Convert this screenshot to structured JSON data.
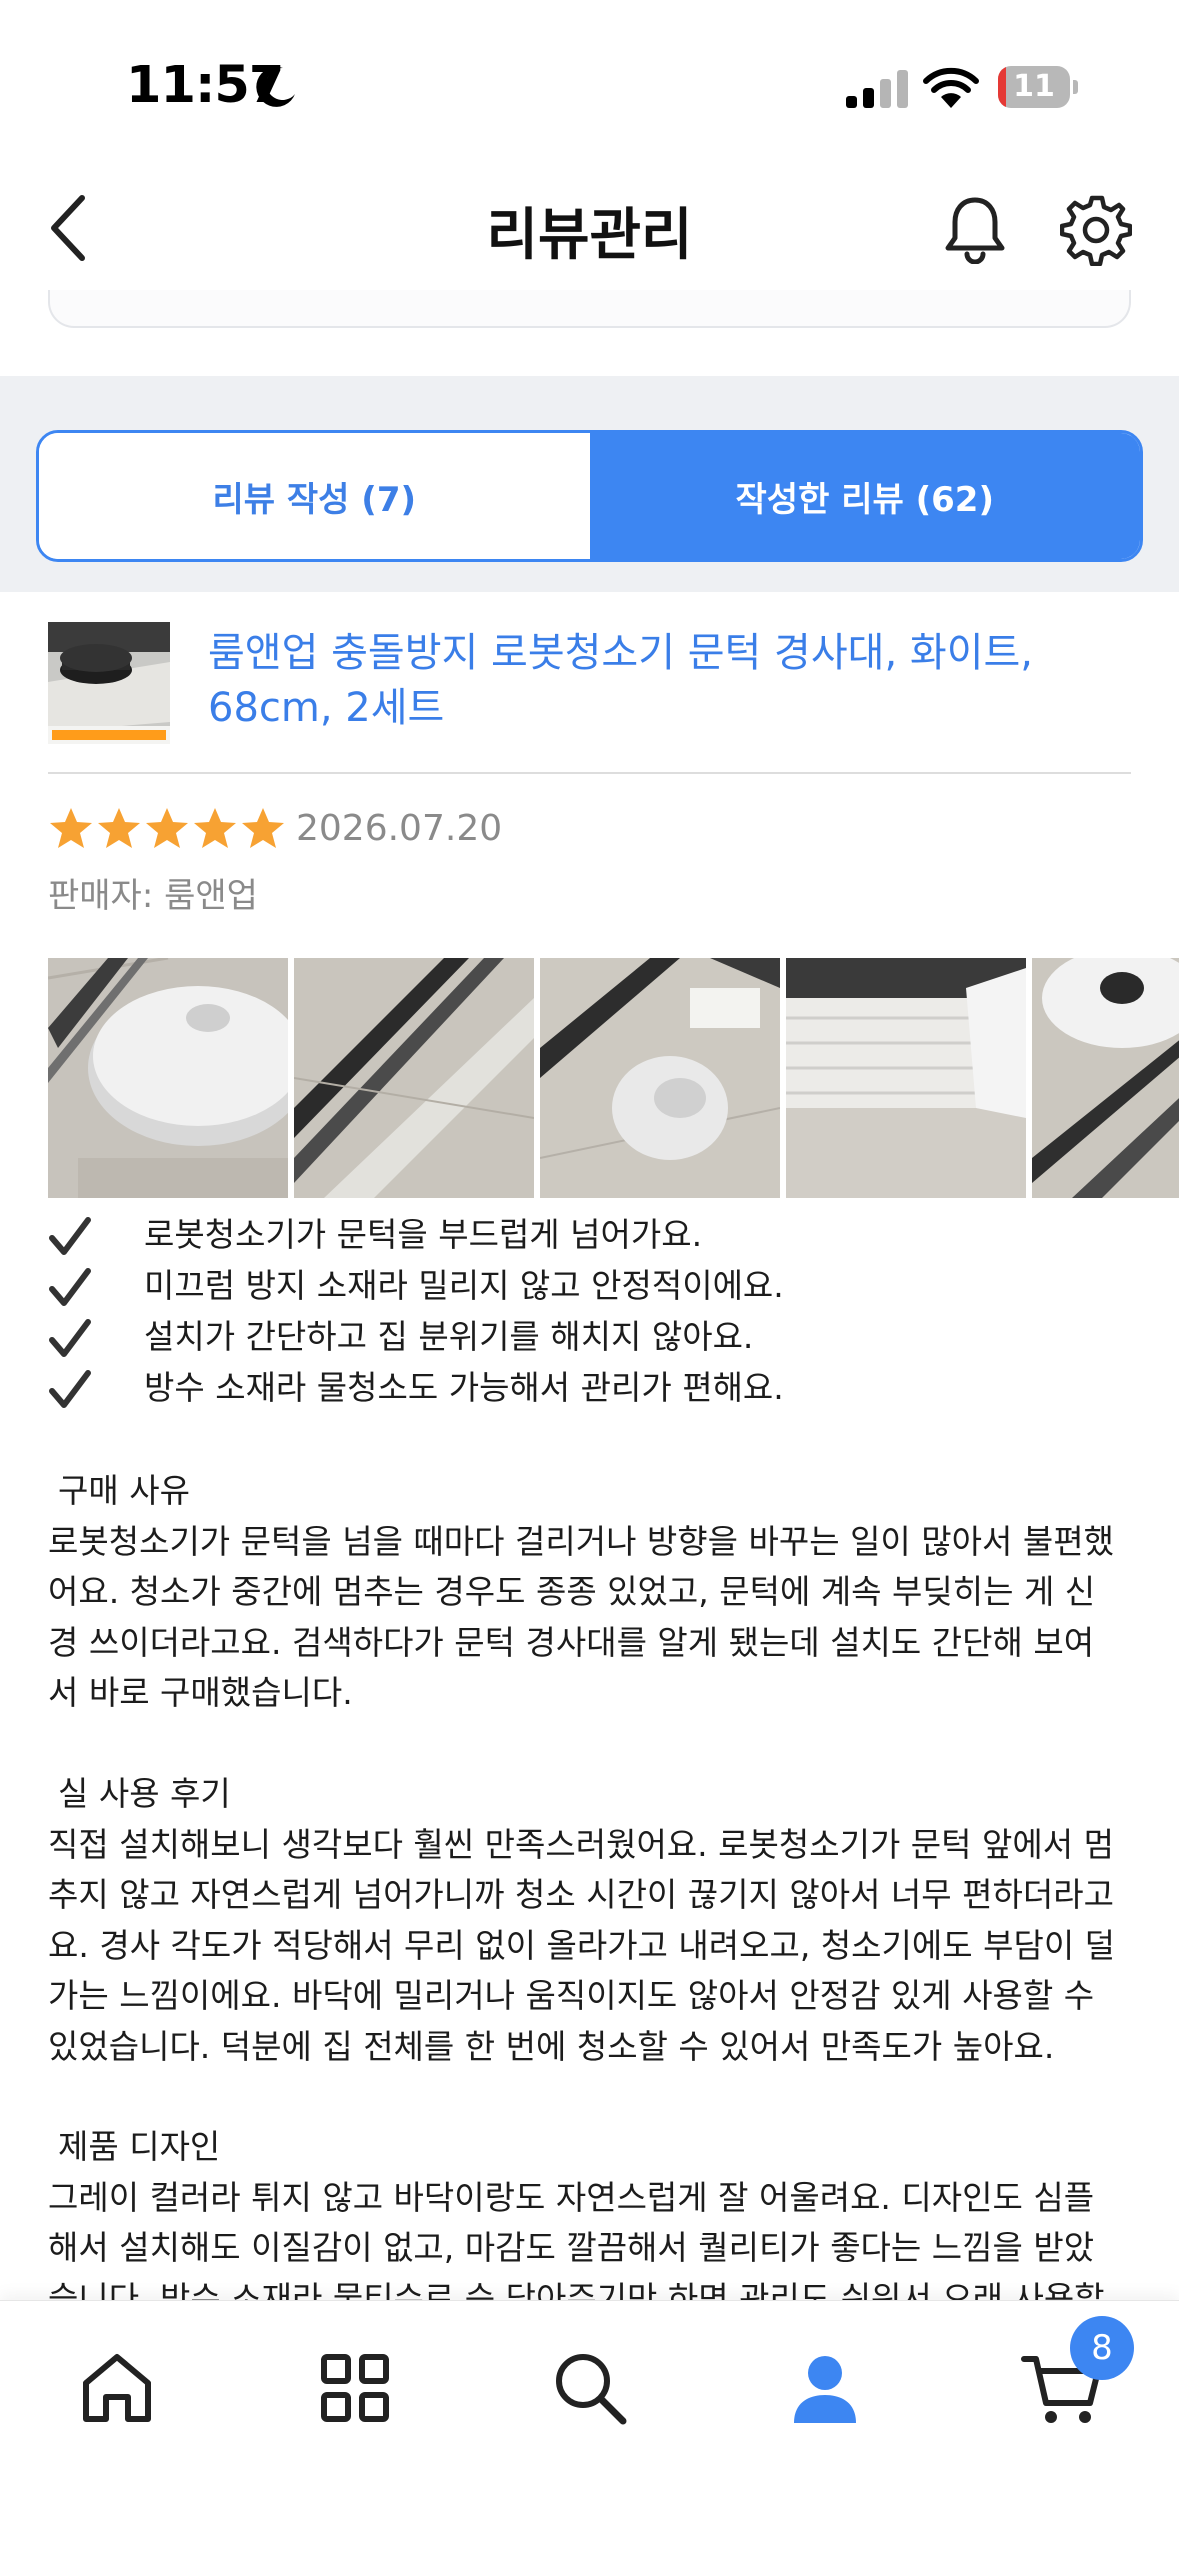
{
  "status_bar": {
    "time": "11:57",
    "battery_level": "11",
    "battery_fraction": 0.11,
    "icons": [
      "moon-icon",
      "signal-icon",
      "wifi-icon",
      "battery-icon"
    ]
  },
  "header": {
    "title": "리뷰관리",
    "icons": [
      "back-chevron-icon",
      "bell-icon",
      "gear-icon"
    ]
  },
  "tabs": [
    {
      "label": "리뷰 작성 (7)",
      "selected": false
    },
    {
      "label": "작성한 리뷰 (62)",
      "selected": true
    }
  ],
  "review": {
    "product_title": "룸앤업 충돌방지 로봇청소기 문턱 경사대, 화이트, 68cm, 2세트",
    "rating": 5,
    "date": "2026.07.20",
    "seller": "판매자: 룸앤업",
    "checklist": [
      "로봇청소기가 문턱을 부드럽게 넘어가요.",
      "미끄럼 방지 소재라 밀리지 않고 안정적이에요.",
      "설치가 간단하고 집 분위기를 해치지 않아요.",
      "방수 소재라 물청소도 가능해서 관리가 편해요."
    ],
    "sections": [
      {
        "heading": "구매 사유",
        "lines": [
          "로봇청소기가 문턱을 넘을 때마다 걸리거나 방향을 바꾸는 일이 많아서 불편했",
          "어요. 청소가 중간에 멈추는 경우도 종종 있었고, 문턱에 계속 부딪히는 게 신",
          "경 쓰이더라고요. 검색하다가 문턱 경사대를 알게 됐는데 설치도 간단해 보여",
          "서 바로 구매했습니다."
        ]
      },
      {
        "heading": "실 사용 후기",
        "lines": [
          "직접 설치해보니 생각보다 훨씬 만족스러웠어요. 로봇청소기가 문턱 앞에서 멈",
          "추지 않고 자연스럽게 넘어가니까 청소 시간이 끊기지 않아서 너무 편하더라고",
          "요. 경사 각도가 적당해서 무리 없이 올라가고 내려오고, 청소기에도 부담이 덜",
          "가는 느낌이에요. 바닥에 밀리거나 움직이지도 않아서 안정감 있게 사용할 수",
          "있었습니다. 덕분에 집 전체를 한 번에 청소할 수 있어서 만족도가 높아요."
        ]
      },
      {
        "heading": "제품 디자인",
        "lines": [
          "그레이 컬러라 튀지 않고 바닥이랑도 자연스럽게 잘 어울려요. 디자인도 심플",
          "해서 설치해도 이질감이 없고, 마감도 깔끔해서 퀄리티가 좋다는 느낌을 받았",
          "습니다. 방수 소재라 물티슈로 슥 닦아주기만 하면 관리도 쉬워서 오래 사용할"
        ]
      }
    ]
  },
  "bottom_nav": {
    "items": [
      "home-icon",
      "grid-icon",
      "search-icon",
      "user-icon",
      "cart-icon"
    ],
    "cart_badge": "8",
    "accent_color": "#3d86f2"
  }
}
